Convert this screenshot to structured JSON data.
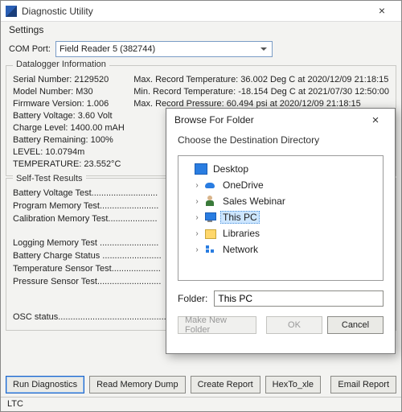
{
  "window": {
    "title": "Diagnostic Utility",
    "menu": {
      "settings": "Settings"
    },
    "comport": {
      "label": "COM Port:",
      "value": "Field Reader 5 (382744)"
    }
  },
  "info": {
    "legend": "Datalogger Information",
    "left": {
      "serial": "Serial Number: 2129520",
      "model": "Model Number: M30",
      "fw": "Firmware Version:  1.006",
      "batt_v": "Battery Voltage: 3.60 Volt",
      "charge": "Charge Level: 1400.00 mAH",
      "batt_r": "Battery Remaining: 100%",
      "level": "LEVEL: 10.0794m",
      "temp": "TEMPERATURE: 23.552°C"
    },
    "right": {
      "maxt": "Max. Record Temperature: 36.002 Deg C at 2020/12/09 21:18:15",
      "mint": "Min. Record Temperature: -18.154 Deg C at 2021/07/30 12:50:00",
      "maxp": "Max. Record Pressure: 60.494 psi at 2020/12/09 21:18:15"
    }
  },
  "tests": {
    "legend": "Self-Test Results",
    "lines": {
      "bv": "Battery Voltage Test...........................",
      "pm": "Program Memory Test........................",
      "cm": "Calibration Memory Test....................",
      "gap": "",
      "lm": "Logging Memory Test ........................",
      "bc": "Battery Charge Status ........................",
      "ts": "Temperature Sensor Test....................",
      "ps": "Pressure Sensor Test..........................",
      "gap2": "",
      "gap3": "",
      "osc": "OSC status............................................"
    }
  },
  "buttons": {
    "run": "Run Diagnostics",
    "read": "Read Memory Dump",
    "create": "Create Report",
    "hex": "HexTo_xle",
    "email": "Email Report"
  },
  "status": "LTC",
  "dialog": {
    "title": "Browse For Folder",
    "subtitle": "Choose the Destination Directory",
    "nodes": {
      "desktop": "Desktop",
      "onedrive": "OneDrive",
      "sales": "Sales Webinar",
      "thispc": "This PC",
      "libs": "Libraries",
      "net": "Network"
    },
    "folder_label": "Folder:",
    "folder_value": "This PC",
    "btn_new": "Make New Folder",
    "btn_ok": "OK",
    "btn_cancel": "Cancel"
  }
}
